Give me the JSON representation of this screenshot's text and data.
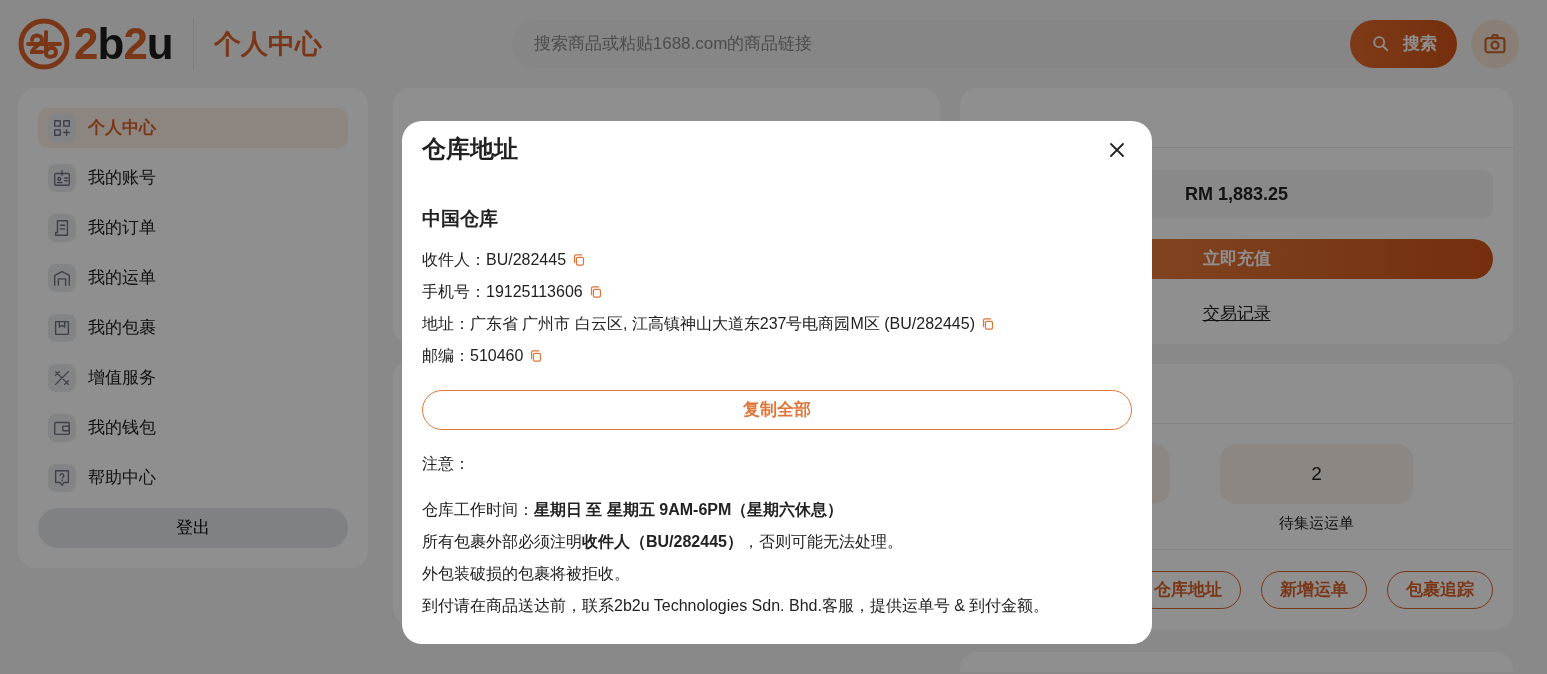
{
  "header": {
    "logo_text": "2b2u",
    "page_title": "个人中心",
    "search": {
      "placeholder": "搜索商品或粘贴1688.com的商品链接",
      "button": "搜索"
    }
  },
  "sidebar": {
    "items": [
      {
        "label": "个人中心",
        "kind": "grid",
        "selected": true
      },
      {
        "label": "我的账号",
        "kind": "badge",
        "selected": false
      },
      {
        "label": "我的订单",
        "kind": "receipt",
        "selected": false
      },
      {
        "label": "我的运单",
        "kind": "warehouse",
        "selected": false
      },
      {
        "label": "我的包裹",
        "kind": "package",
        "selected": false
      },
      {
        "label": "增值服务",
        "kind": "tools",
        "selected": false
      },
      {
        "label": "我的钱包",
        "kind": "wallet",
        "selected": false
      },
      {
        "label": "帮助中心",
        "kind": "help",
        "selected": false
      }
    ],
    "logout": "登出"
  },
  "balance": {
    "amount": "RM 1,883.25",
    "recharge": "立即充值",
    "history": "交易记录"
  },
  "shipments": {
    "stats": [
      {
        "value": "2",
        "label": "待集运运单"
      }
    ],
    "actions": [
      "仓库地址",
      "新增运单",
      "包裹追踪"
    ]
  },
  "modal": {
    "title": "仓库地址",
    "section": "中国仓库",
    "fields": [
      {
        "label": "收件人：",
        "value": "BU/282445"
      },
      {
        "label": "手机号：",
        "value": "19125113606"
      },
      {
        "label": "地址：",
        "value": "广东省 广州市 白云区, 江高镇神山大道东237号电商园M区 (BU/282445)"
      },
      {
        "label": "邮编：",
        "value": "510460"
      }
    ],
    "copy_all": "复制全部",
    "note_heading": "注意：",
    "notes": [
      "仓库工作时间：**星期日 至 星期五 9AM-6PM（星期六休息）**",
      "所有包裹外部必须注明**收件人（BU/282445）**，否则可能无法处理。",
      "外包装破损的包裹将被拒收。",
      "到付请在商品送达前，联系2b2u Technologies Sdn. Bhd.客服，提供运单号 & 到付金额。"
    ]
  }
}
